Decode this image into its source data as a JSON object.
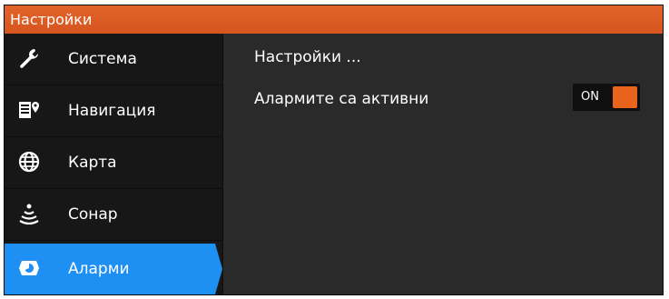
{
  "title": "Настройки",
  "sidebar": {
    "items": [
      {
        "label": "Система",
        "icon": "wrench-icon"
      },
      {
        "label": "Навигация",
        "icon": "navigation-icon"
      },
      {
        "label": "Карта",
        "icon": "globe-icon"
      },
      {
        "label": "Сонар",
        "icon": "sonar-icon"
      },
      {
        "label": "Аларми",
        "icon": "alarm-icon",
        "active": true
      }
    ]
  },
  "main": {
    "heading": "Настройки ...",
    "alarms_row": {
      "label": "Алармите са активни",
      "toggle_text": "ON",
      "toggle_state": "on"
    }
  },
  "colors": {
    "accent": "#e3642a",
    "selected": "#1e8ff3",
    "toggle_on": "#e8641c"
  }
}
